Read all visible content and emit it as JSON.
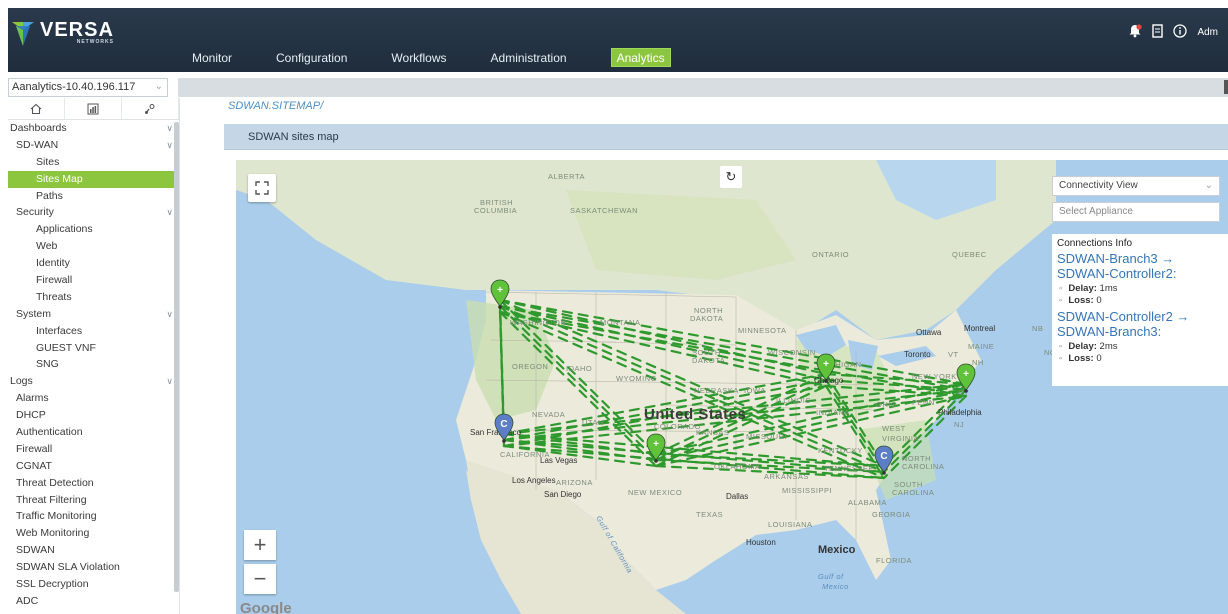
{
  "header": {
    "brand": "VERSA",
    "brand_sub": "NETWORKS",
    "nav": [
      {
        "label": "Monitor"
      },
      {
        "label": "Configuration"
      },
      {
        "label": "Workflows"
      },
      {
        "label": "Administration"
      },
      {
        "label": "Analytics"
      }
    ],
    "active_nav": "Analytics",
    "user_label": "Adm"
  },
  "appliance_selector": {
    "value": "Aanalytics-10.40.196.117"
  },
  "sidebar": {
    "menu": [
      {
        "label": "Dashboards",
        "level": 0,
        "chevron": true
      },
      {
        "label": "SD-WAN",
        "level": 1,
        "chevron": true
      },
      {
        "label": "Sites",
        "level": 2
      },
      {
        "label": "Sites Map",
        "level": 2,
        "selected": true
      },
      {
        "label": "Paths",
        "level": 2
      },
      {
        "label": "Security",
        "level": 1,
        "chevron": true
      },
      {
        "label": "Applications",
        "level": 2
      },
      {
        "label": "Web",
        "level": 2
      },
      {
        "label": "Identity",
        "level": 2
      },
      {
        "label": "Firewall",
        "level": 2
      },
      {
        "label": "Threats",
        "level": 2
      },
      {
        "label": "System",
        "level": 1,
        "chevron": true
      },
      {
        "label": "Interfaces",
        "level": 2
      },
      {
        "label": "GUEST VNF",
        "level": 2
      },
      {
        "label": "SNG",
        "level": 2
      },
      {
        "label": "Logs",
        "level": 0,
        "chevron": true
      },
      {
        "label": "Alarms",
        "level": 1
      },
      {
        "label": "DHCP",
        "level": 1
      },
      {
        "label": "Authentication",
        "level": 1
      },
      {
        "label": "Firewall",
        "level": 1
      },
      {
        "label": "CGNAT",
        "level": 1
      },
      {
        "label": "Threat Detection",
        "level": 1
      },
      {
        "label": "Threat Filtering",
        "level": 1
      },
      {
        "label": "Traffic Monitoring",
        "level": 1
      },
      {
        "label": "Web Monitoring",
        "level": 1
      },
      {
        "label": "SDWAN",
        "level": 1
      },
      {
        "label": "SDWAN SLA Violation",
        "level": 1
      },
      {
        "label": "SSL Decryption",
        "level": 1
      },
      {
        "label": "ADC",
        "level": 1
      }
    ]
  },
  "breadcrumb": "SDWAN.SITEMAP/",
  "panel_title": "SDWAN sites map",
  "map": {
    "labels": [
      {
        "text": "ALBERTA",
        "cls": ""
      },
      {
        "text": "BRITISH",
        "cls": ""
      },
      {
        "text": "COLUMBIA",
        "cls": ""
      },
      {
        "text": "SASKATCHEWAN",
        "cls": ""
      },
      {
        "text": "ONTARIO",
        "cls": ""
      },
      {
        "text": "QUEBEC",
        "cls": ""
      },
      {
        "text": "NORTH",
        "cls": ""
      },
      {
        "text": "DAKOTA",
        "cls": ""
      },
      {
        "text": "MINNESOTA",
        "cls": ""
      },
      {
        "text": "WASHINGTON",
        "cls": ""
      },
      {
        "text": "MONTANA",
        "cls": ""
      },
      {
        "text": "SOUTH",
        "cls": ""
      },
      {
        "text": "DAKOTA",
        "cls": ""
      },
      {
        "text": "WISCONSIN",
        "cls": ""
      },
      {
        "text": "MICHIGAN",
        "cls": ""
      },
      {
        "text": "OREGON",
        "cls": ""
      },
      {
        "text": "IDAHO",
        "cls": ""
      },
      {
        "text": "WYOMING",
        "cls": ""
      },
      {
        "text": "NEBRASKA",
        "cls": ""
      },
      {
        "text": "IOWA",
        "cls": ""
      },
      {
        "text": "ILLINOIS",
        "cls": ""
      },
      {
        "text": "INDIANA",
        "cls": ""
      },
      {
        "text": "OHIO",
        "cls": ""
      },
      {
        "text": "PENN",
        "cls": ""
      },
      {
        "text": "NEVADA",
        "cls": ""
      },
      {
        "text": "UTAH",
        "cls": ""
      },
      {
        "text": "COLORADO",
        "cls": ""
      },
      {
        "text": "KANSAS",
        "cls": ""
      },
      {
        "text": "MISSOURI",
        "cls": ""
      },
      {
        "text": "KENTUCKY",
        "cls": ""
      },
      {
        "text": "WEST",
        "cls": ""
      },
      {
        "text": "VIRGINIA",
        "cls": ""
      },
      {
        "text": "CALIFORNIA",
        "cls": ""
      },
      {
        "text": "ARIZONA",
        "cls": ""
      },
      {
        "text": "NEW MEXICO",
        "cls": ""
      },
      {
        "text": "OKLAHOMA",
        "cls": ""
      },
      {
        "text": "ARKANSAS",
        "cls": ""
      },
      {
        "text": "TENNESSEE",
        "cls": ""
      },
      {
        "text": "NORTH",
        "cls": ""
      },
      {
        "text": "CAROLINA",
        "cls": ""
      },
      {
        "text": "SOUTH",
        "cls": ""
      },
      {
        "text": "CAROLINA",
        "cls": ""
      },
      {
        "text": "MISSISSIPPI",
        "cls": ""
      },
      {
        "text": "ALABAMA",
        "cls": ""
      },
      {
        "text": "GEORGIA",
        "cls": ""
      },
      {
        "text": "TEXAS",
        "cls": ""
      },
      {
        "text": "LOUISIANA",
        "cls": ""
      },
      {
        "text": "FLORIDA",
        "cls": ""
      },
      {
        "text": "NEW YORK",
        "cls": ""
      },
      {
        "text": "MAINE",
        "cls": ""
      },
      {
        "text": "VT",
        "cls": ""
      },
      {
        "text": "NH",
        "cls": ""
      },
      {
        "text": "NJ",
        "cls": ""
      },
      {
        "text": "NB",
        "cls": ""
      },
      {
        "text": "NOV",
        "cls": ""
      },
      {
        "text": "CT",
        "cls": ""
      },
      {
        "text": "United States",
        "cls": "big"
      },
      {
        "text": "Ottawa",
        "cls": "city"
      },
      {
        "text": "Montreal",
        "cls": "city"
      },
      {
        "text": "Toronto",
        "cls": "city"
      },
      {
        "text": "Chicago",
        "cls": "city"
      },
      {
        "text": "Philadelphia",
        "cls": "city"
      },
      {
        "text": "San Francisco",
        "cls": "city"
      },
      {
        "text": "Las Vegas",
        "cls": "city"
      },
      {
        "text": "Los Angeles",
        "cls": "city"
      },
      {
        "text": "San Diego",
        "cls": "city"
      },
      {
        "text": "Dallas",
        "cls": "city"
      },
      {
        "text": "Houston",
        "cls": "city"
      },
      {
        "text": "Mexico",
        "cls": "country"
      },
      {
        "text": "Gulf of",
        "cls": "water"
      },
      {
        "text": "Mexico",
        "cls": "water"
      },
      {
        "text": "Gulf of California",
        "cls": "water"
      }
    ],
    "google_label": "Google",
    "zoom_in": "+",
    "zoom_out": "−",
    "refresh": "↻",
    "fullscreen": "⛶",
    "colors": {
      "water": "#a9cdea",
      "land": "#e9ead9",
      "park": "#c9dfb0",
      "link": "#2e9a2e",
      "branch_pin": "#5fc23a",
      "controller_pin": "#5b7ec6"
    },
    "sites": [
      {
        "role": "branch",
        "glyph": "+"
      },
      {
        "role": "controller",
        "glyph": "C"
      },
      {
        "role": "branch",
        "glyph": "+"
      },
      {
        "role": "branch",
        "glyph": "+"
      },
      {
        "role": "branch",
        "glyph": "+"
      },
      {
        "role": "controller",
        "glyph": "C"
      }
    ]
  },
  "controls": {
    "view_select": "Connectivity View",
    "appliance_placeholder": "Select Appliance"
  },
  "connections_info": {
    "header": "Connections Info",
    "connections": [
      {
        "title": "SDWAN-Branch3 → SDWAN-Controller2:",
        "delay_label": "Delay:",
        "delay": "1ms",
        "loss_label": "Loss:",
        "loss": "0"
      },
      {
        "title": "SDWAN-Controller2 → SDWAN-Branch3:",
        "delay_label": "Delay:",
        "delay": "2ms",
        "loss_label": "Loss:",
        "loss": "0"
      }
    ]
  }
}
